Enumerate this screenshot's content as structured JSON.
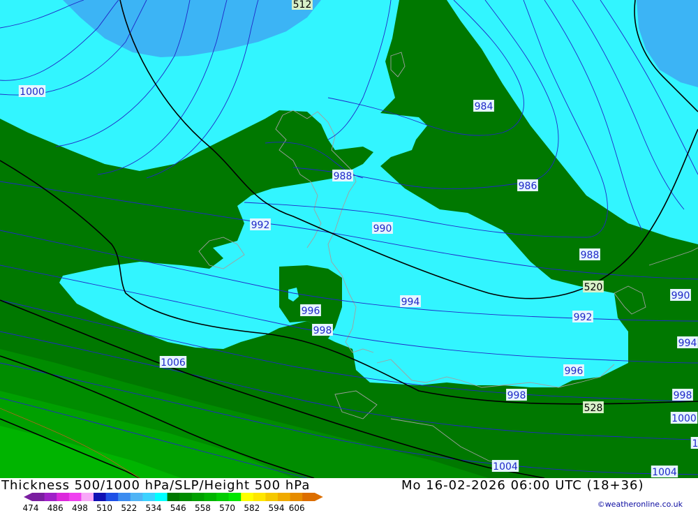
{
  "header": {
    "title_left": "Thickness 500/1000 hPa/SLP/Height 500 hPa",
    "title_right": "Mo 16-02-2026 06:00 UTC (18+36)"
  },
  "credit": "©weatheronline.co.uk",
  "legend": {
    "colors": [
      "#7a1ea0",
      "#a020c8",
      "#dc28dc",
      "#f040f0",
      "#f8a8f8",
      "#1010b4",
      "#1e50e6",
      "#3c8cf0",
      "#50b4f5",
      "#3cd2ff",
      "#00ffff",
      "#007800",
      "#008c00",
      "#00a000",
      "#00b400",
      "#00cc00",
      "#00e600",
      "#ffff00",
      "#ffe600",
      "#f5c800",
      "#f0aa00",
      "#e68c00",
      "#dc6e00"
    ],
    "ticks": [
      "474",
      "486",
      "498",
      "510",
      "522",
      "534",
      "546",
      "558",
      "570",
      "582",
      "594",
      "606"
    ]
  },
  "map": {
    "colors": {
      "band_510_522": "#3cb4f5",
      "band_522_534": "#32f5ff",
      "band_534_546": "#007800",
      "band_546_558": "#008c00",
      "band_558_570": "#00a000",
      "band_570_582": "#00b400",
      "isobar": "#2028c8",
      "height_contour": "#000000",
      "coastline": "#a0a0a0"
    },
    "isobar_labels": [
      "512",
      "1000",
      "984",
      "988",
      "986",
      "992",
      "990",
      "988",
      "520",
      "990",
      "994",
      "996",
      "992",
      "998",
      "994",
      "1006",
      "996",
      "998",
      "998",
      "528",
      "1000",
      "1004",
      "1004",
      "1"
    ],
    "label_kinds": [
      "height",
      "pressure",
      "pressure",
      "pressure",
      "pressure",
      "pressure",
      "pressure",
      "pressure",
      "height",
      "pressure",
      "pressure",
      "pressure",
      "pressure",
      "pressure",
      "pressure",
      "pressure",
      "pressure",
      "pressure",
      "pressure",
      "height",
      "pressure",
      "pressure",
      "pressure",
      "pressure"
    ]
  }
}
